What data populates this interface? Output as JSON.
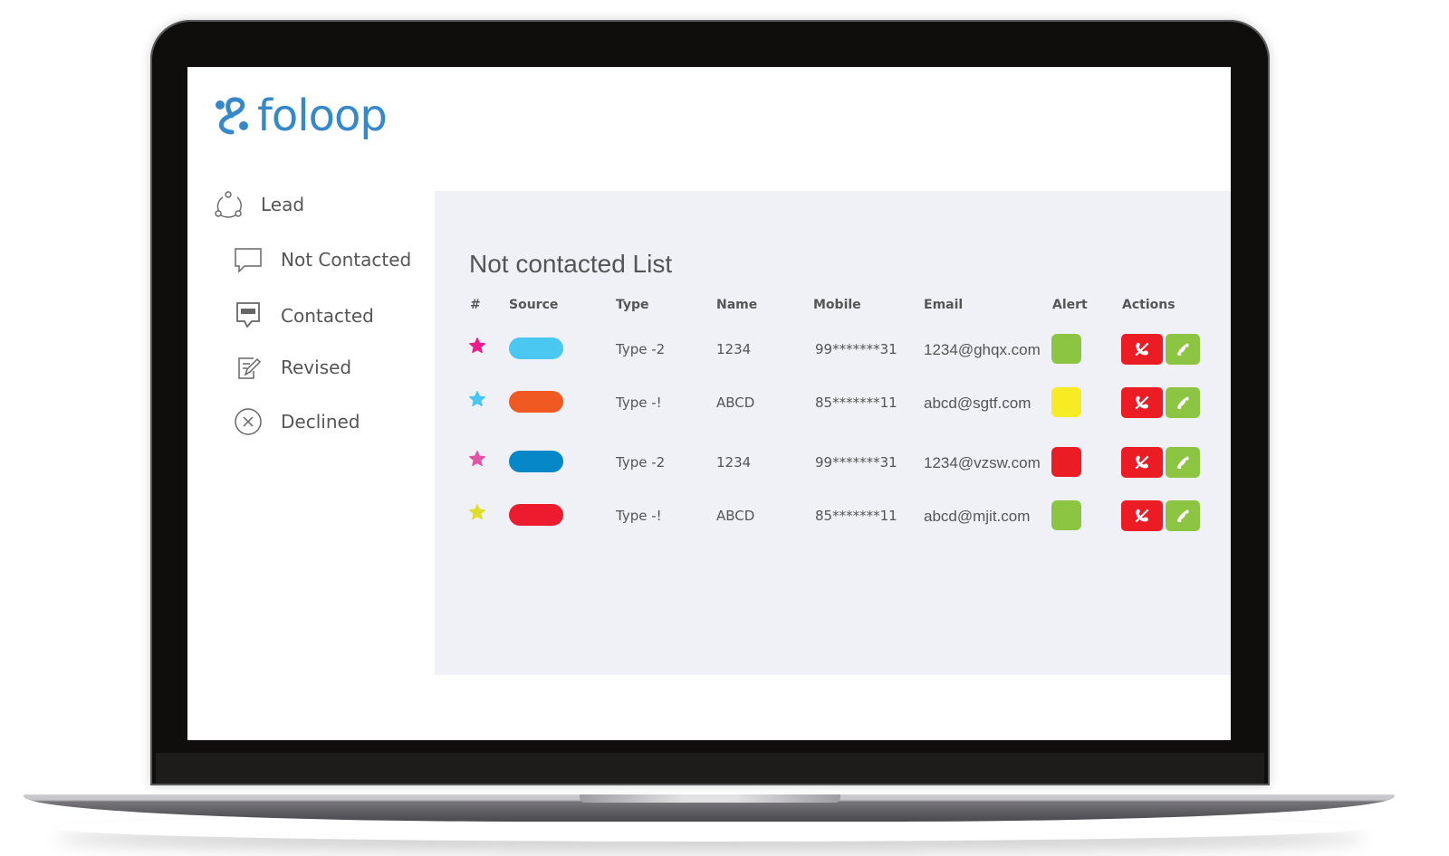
{
  "app": {
    "brand": "foloop",
    "brand_color": "#3589cb"
  },
  "sidebar": {
    "items": [
      {
        "label": "Lead",
        "icon": "share-nodes-icon"
      },
      {
        "label": "Not Contacted",
        "icon": "speech-bubble-icon"
      },
      {
        "label": "Contacted",
        "icon": "message-filled-icon"
      },
      {
        "label": "Revised",
        "icon": "edit-note-icon"
      },
      {
        "label": "Declined",
        "icon": "close-circle-icon"
      }
    ]
  },
  "main": {
    "title": "Not contacted List",
    "columns": [
      "#",
      "Source",
      "Type",
      "Name",
      "Mobile",
      "Email",
      "Alert",
      "Actions"
    ],
    "rows": [
      {
        "star_color": "#ec1c8c",
        "source_color": "#4ac8f2",
        "type": "Type -2",
        "name": "1234",
        "mobile": "99*******31",
        "email": "1234@ghqx.com",
        "alert_color": "#8bc541"
      },
      {
        "star_color": "#46c6f2",
        "source_color": "#f05a22",
        "type": "Type -!",
        "name": "ABCD",
        "mobile": "85*******11",
        "email": "abcd@sgtf.com",
        "alert_color": "#f7ec24"
      },
      {
        "star_color": "#e056a5",
        "source_color": "#0687c8",
        "type": "Type -2",
        "name": "1234",
        "mobile": "99*******31",
        "email": "1234@vzsw.com",
        "alert_color": "#ec1c24"
      },
      {
        "star_color": "#e2dd2a",
        "source_color": "#ec1c2e",
        "type": "Type -!",
        "name": "ABCD",
        "mobile": "85*******11",
        "email": "abcd@mjit.com",
        "alert_color": "#8bc541"
      }
    ],
    "actions": {
      "decline_color": "#ec1c24",
      "call_color": "#8bc541",
      "decline_icon": "hang-up-icon",
      "call_icon": "phone-icon"
    }
  }
}
